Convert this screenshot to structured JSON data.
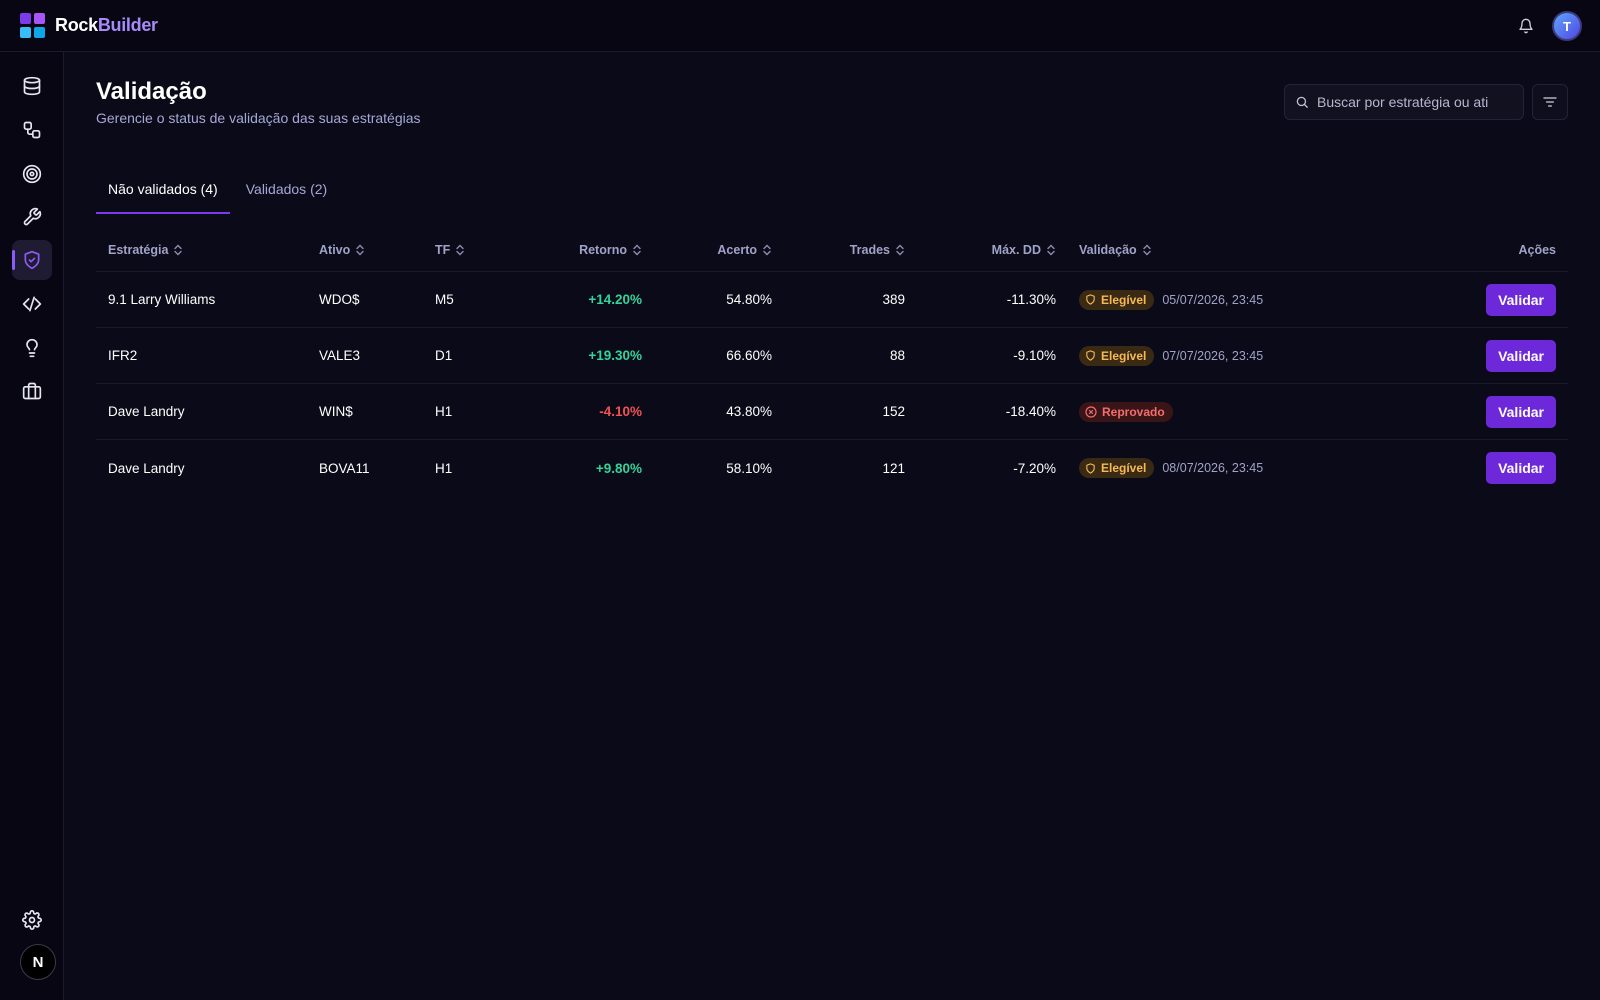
{
  "brand": {
    "name_part1": "Rock",
    "name_part2": "Builder",
    "colors": [
      "#7c3aed",
      "#a855f7",
      "#38bdf8",
      "#0ea5e9"
    ]
  },
  "header": {
    "avatar_initial": "T",
    "notifications_icon": "bell-icon"
  },
  "sidebar": {
    "items": [
      {
        "icon": "database-icon"
      },
      {
        "icon": "workflow-icon"
      },
      {
        "icon": "target-icon"
      },
      {
        "icon": "wrench-icon"
      },
      {
        "icon": "shield-check-icon",
        "active": true
      },
      {
        "icon": "code-icon"
      },
      {
        "icon": "lightbulb-icon"
      },
      {
        "icon": "briefcase-icon"
      }
    ],
    "settings_icon": "gear-icon",
    "bottom_badge": "N"
  },
  "page": {
    "title": "Validação",
    "subtitle": "Gerencie o status de validação das suas estratégias",
    "search_placeholder": "Buscar por estratégia ou ati"
  },
  "tabs": [
    {
      "label": "Não validados (4)",
      "active": true
    },
    {
      "label": "Validados (2)",
      "active": false
    }
  ],
  "table": {
    "headers": {
      "strategy": "Estratégia",
      "asset": "Ativo",
      "tf": "TF",
      "return": "Retorno",
      "accuracy": "Acerto",
      "trades": "Trades",
      "max_dd": "Máx. DD",
      "validation": "Validação",
      "actions": "Ações"
    },
    "action_label": "Validar",
    "rows": [
      {
        "strategy": "9.1 Larry Williams",
        "asset": "WDO$",
        "tf": "M5",
        "return": "+14.20%",
        "accuracy": "54.80%",
        "trades": "389",
        "max_dd": "-11.30%",
        "status": "Elegível",
        "status_kind": "eleg",
        "date": "05/07/2026, 23:45"
      },
      {
        "strategy": "IFR2",
        "asset": "VALE3",
        "tf": "D1",
        "return": "+19.30%",
        "accuracy": "66.60%",
        "trades": "88",
        "max_dd": "-9.10%",
        "status": "Elegível",
        "status_kind": "eleg",
        "date": "07/07/2026, 23:45"
      },
      {
        "strategy": "Dave Landry",
        "asset": "WIN$",
        "tf": "H1",
        "return": "-4.10%",
        "accuracy": "43.80%",
        "trades": "152",
        "max_dd": "-18.40%",
        "status": "Reprovado",
        "status_kind": "rep",
        "date": ""
      },
      {
        "strategy": "Dave Landry",
        "asset": "BOVA11",
        "tf": "H1",
        "return": "+9.80%",
        "accuracy": "58.10%",
        "trades": "121",
        "max_dd": "-7.20%",
        "status": "Elegível",
        "status_kind": "eleg",
        "date": "08/07/2026, 23:45"
      }
    ]
  }
}
